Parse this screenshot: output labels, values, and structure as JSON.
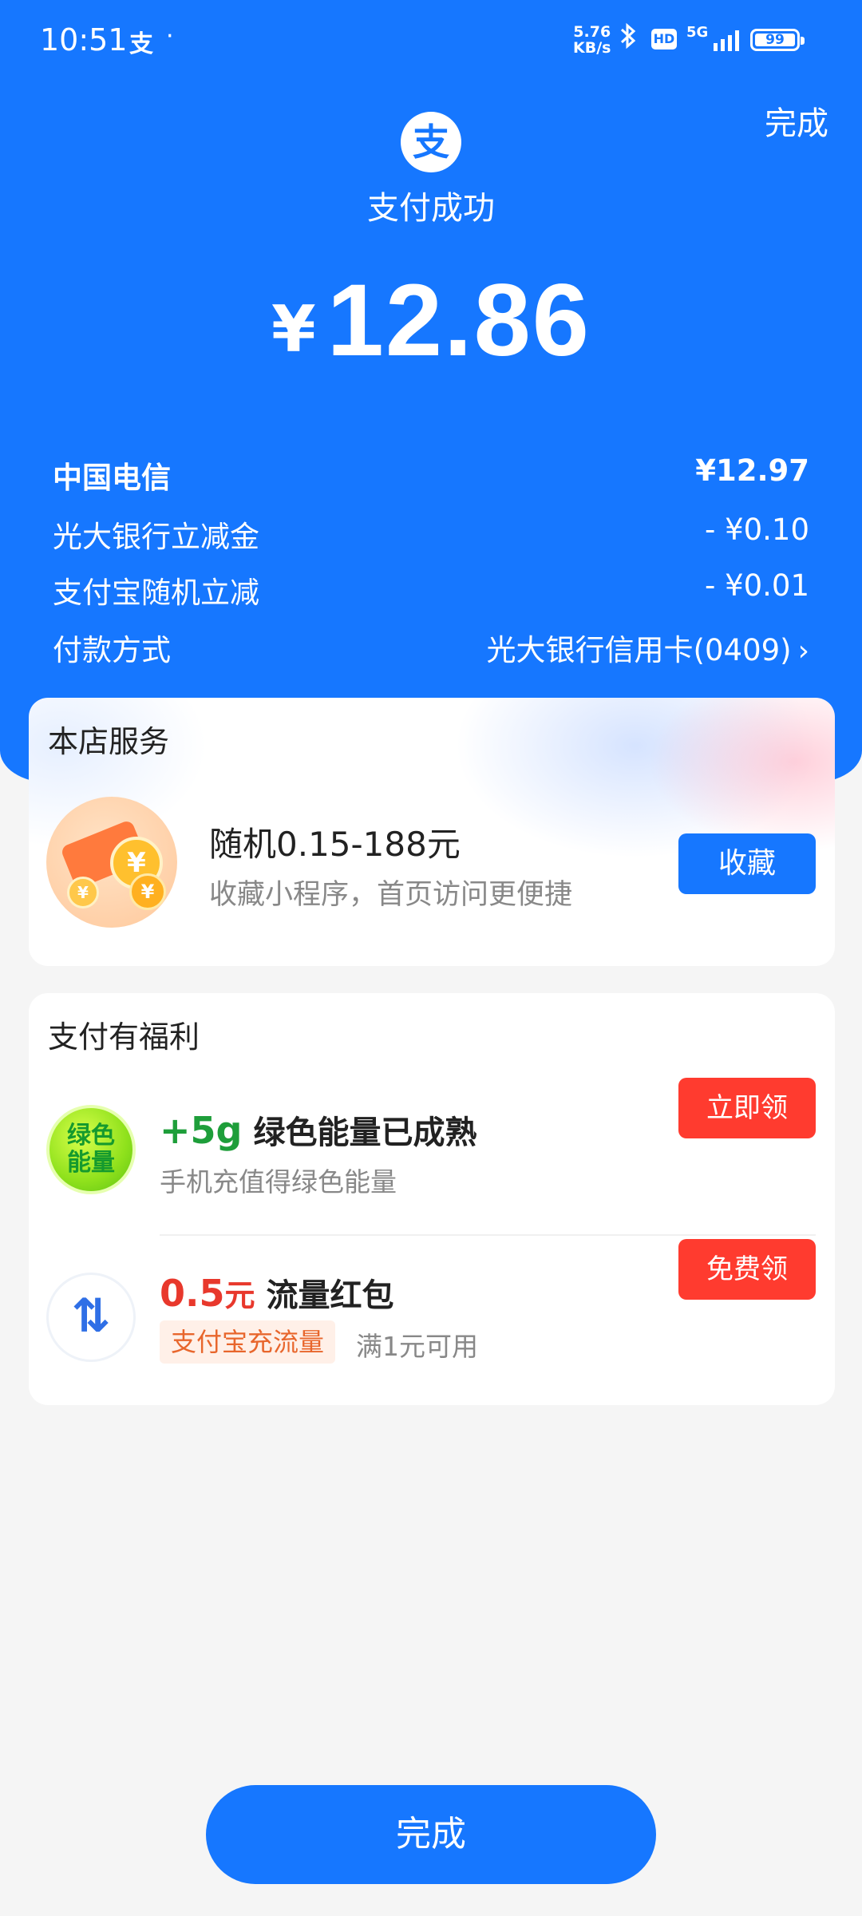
{
  "status_bar": {
    "time": "10:51",
    "app_indicator": "支",
    "dot": "·",
    "speed_value": "5.76",
    "speed_unit": "KB/s",
    "hd": "HD",
    "network": "5G",
    "battery": "99"
  },
  "header": {
    "done_label": "完成",
    "logo_glyph": "支",
    "title": "支付成功",
    "currency_symbol": "¥",
    "amount": "12.86"
  },
  "details": [
    {
      "label": "中国电信",
      "value": "¥12.97"
    },
    {
      "label": "光大银行立减金",
      "value": "- ¥0.10"
    },
    {
      "label": "支付宝随机立减",
      "value": "- ¥0.01"
    },
    {
      "label": "付款方式",
      "value": "光大银行信用卡(0409)"
    }
  ],
  "store_service": {
    "title": "本店服务",
    "item_title": "随机0.15-188元",
    "item_subtitle": "收藏小程序，首页访问更便捷",
    "button_label": "收藏",
    "coin_glyph": "¥"
  },
  "benefits": {
    "title": "支付有福利",
    "energy": {
      "icon_text_line1": "绿色",
      "icon_text_line2": "能量",
      "amount": "+5g",
      "title": "绿色能量已成熟",
      "subtitle": "手机充值得绿色能量",
      "button_label": "立即领"
    },
    "data_packet": {
      "amount": "0.5",
      "unit": "元",
      "title": "流量红包",
      "tag": "支付宝充流量",
      "note": "满1元可用",
      "button_label": "免费领"
    }
  },
  "footer": {
    "done_label": "完成"
  },
  "colors": {
    "brand_blue": "#1677ff",
    "action_red": "#ff3b2f",
    "energy_green": "#1e9e3a",
    "price_red": "#e8382c"
  }
}
